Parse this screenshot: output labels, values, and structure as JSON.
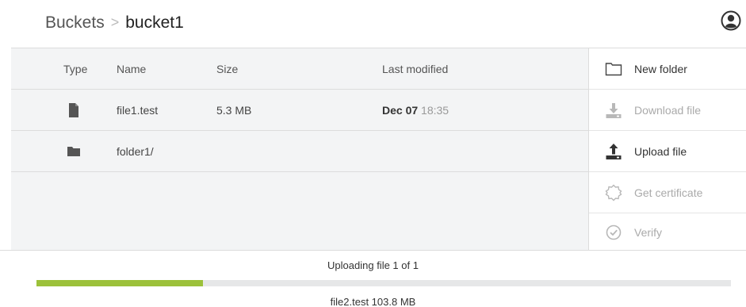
{
  "breadcrumb": {
    "root": "Buckets",
    "separator": ">",
    "current": "bucket1"
  },
  "header": {
    "account_icon": "user-circle-icon"
  },
  "table": {
    "columns": [
      "Type",
      "Name",
      "Size",
      "Last modified"
    ],
    "rows": [
      {
        "type_icon": "file-icon",
        "name": "file1.test",
        "size": "5.3 MB",
        "modified_date": "Dec 07",
        "modified_time": "18:35"
      },
      {
        "type_icon": "folder-icon",
        "name": "folder1/",
        "size": "",
        "modified_date": "",
        "modified_time": ""
      }
    ]
  },
  "actions": [
    {
      "label": "New folder",
      "icon": "folder-outline-icon",
      "enabled": true
    },
    {
      "label": "Download file",
      "icon": "download-icon",
      "enabled": false
    },
    {
      "label": "Upload file",
      "icon": "upload-icon",
      "enabled": true
    },
    {
      "label": "Get certificate",
      "icon": "certificate-icon",
      "enabled": false
    },
    {
      "label": "Verify",
      "icon": "check-circle-icon",
      "enabled": false
    }
  ],
  "upload": {
    "status": "Uploading file 1 of 1",
    "progress_fraction": 0.24,
    "file": "file2.test 103.8 MB"
  },
  "colors": {
    "progress_fill": "#9cc13a",
    "progress_track": "#e6e7e8",
    "panel_bg": "#f3f4f5"
  }
}
